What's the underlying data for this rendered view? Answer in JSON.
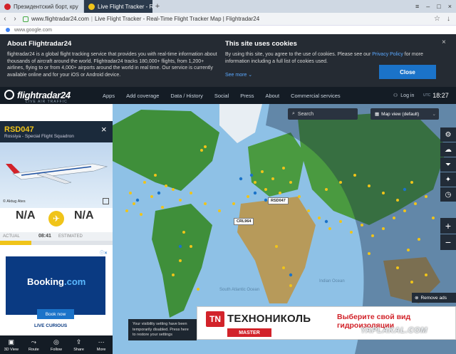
{
  "browser": {
    "tabs": [
      {
        "label": "Президентский борт, кру",
        "active": false
      },
      {
        "label": "Live Flight Tracker - Rea",
        "active": true
      }
    ],
    "new_tab": "+",
    "url": "www.flightradar24.com",
    "page_title": "Live Flight Tracker - Real-Time Flight Tracker Map | Flightradar24",
    "suggestion": "www.google.com"
  },
  "cookie": {
    "about_title": "About Flightradar24",
    "about_text": "flightradar24 is a global flight tracking service that provides you with real-time information about thousands of aircraft around the world. Flightradar24 tracks 180,000+ flights, from 1,200+ airlines, flying to or from 4,000+ airports around the world in real time. Our service is currently available online and for your iOS or Android device.",
    "see_more": "See more",
    "site_title": "This site uses cookies",
    "site_text_1": "By using this site, you agree to the use of cookies. Please see our",
    "privacy_link": "Privacy Policy",
    "site_text_2": "for more information including a full list of cookies used.",
    "close_label": "Close"
  },
  "nav": {
    "logo_text": "flightradar24",
    "logo_sub": "LIVE AIR TRAFFIC",
    "items": [
      "Apps",
      "Add coverage",
      "Data / History",
      "Social",
      "Press",
      "About",
      "Commercial services"
    ],
    "login": "Log in",
    "utc_label": "UTC",
    "time": "18:27"
  },
  "map": {
    "search_label": "Search",
    "view_label": "Map view (default)",
    "remove_ads": "Remove ads",
    "toast": "Your visibility setting have been temporarily disabled. Press here to restore your settings",
    "callsigns": [
      "RSD047",
      "CRL964"
    ],
    "ocean_labels": [
      "South Atlantic Ocean",
      "Indian Ocean"
    ]
  },
  "flight": {
    "callsign": "RSD047",
    "operator": "Rossiya - Special Flight Squadron",
    "photo_credit": "© Aktug Ates",
    "origin": "N/A",
    "destination": "N/A",
    "actual_label": "ACTUAL",
    "actual_time": "08:41",
    "estimated_label": "ESTIMATED",
    "progress": 0.28
  },
  "book_ad": {
    "brand": "Booking",
    "brand_suffix": ".com",
    "cta": "Book now",
    "tagline": "LIVE CURIOUS"
  },
  "bottom_bar": [
    "3D View",
    "Route",
    "Follow",
    "Share",
    "More"
  ],
  "banner_ad": {
    "logo": "TN",
    "name": "ТЕХНОНИКОЛЬ",
    "badge": "MASTER",
    "slogan": "Выберите свой вид гидроизоляции"
  },
  "watermark": "YAPLAKAL.COM",
  "colors": {
    "accent_yellow": "#f0c419",
    "nav_bg": "#141c25",
    "ocean": "#8ec1e6",
    "land": "#3f8f3a",
    "link_blue": "#1b73c9"
  }
}
